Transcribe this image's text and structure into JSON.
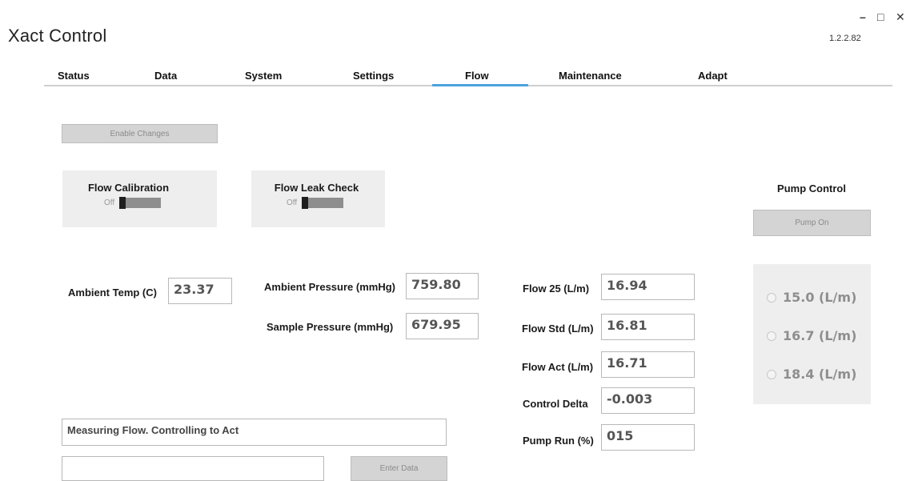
{
  "window": {
    "title": "Xact Control",
    "version": "1.2.2.82",
    "min": "–",
    "max": "□",
    "close": "✕"
  },
  "tabs": [
    {
      "label": "Status"
    },
    {
      "label": "Data"
    },
    {
      "label": "System"
    },
    {
      "label": "Settings"
    },
    {
      "label": "Flow",
      "active": true
    },
    {
      "label": "Maintenance"
    },
    {
      "label": "Adapt"
    }
  ],
  "accent_color": "#4aa3df",
  "enable_changes": {
    "label": "Enable Changes"
  },
  "flow_calibration": {
    "title": "Flow Calibration",
    "state": "Off"
  },
  "flow_leak_check": {
    "title": "Flow Leak Check",
    "state": "Off"
  },
  "ambient": {
    "temp_label": "Ambient Temp (C)",
    "temp_value": "23.37",
    "pressure_label": "Ambient Pressure (mmHg)",
    "pressure_value": "759.80",
    "sample_label": "Sample Pressure (mmHg)",
    "sample_value": "679.95"
  },
  "flow": {
    "flow25_label": "Flow 25 (L/m)",
    "flow25_value": "16.94",
    "std_label": "Flow Std (L/m)",
    "std_value": "16.81",
    "act_label": "Flow Act (L/m)",
    "act_value": "16.71",
    "delta_label": "Control Delta",
    "delta_value": "-0.003",
    "pump_run_label": "Pump Run (%)",
    "pump_run_value": "015"
  },
  "pump_control": {
    "title": "Pump Control",
    "button": "Pump On",
    "options": [
      "15.0 (L/m)",
      "16.7 (L/m)",
      "18.4 (L/m)"
    ]
  },
  "status_message": "Measuring Flow.  Controlling to Act",
  "data_entry": {
    "value": "",
    "button": "Enter Data"
  }
}
